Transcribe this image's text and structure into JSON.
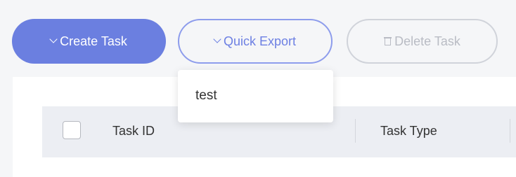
{
  "toolbar": {
    "create_label": "Create Task",
    "export_label": "Quick Export",
    "delete_label": "Delete Task"
  },
  "export_menu": {
    "items": [
      "test"
    ]
  },
  "table": {
    "columns": [
      "Task ID",
      "Task Type"
    ]
  },
  "colors": {
    "primary": "#6b7fe0",
    "primary_border": "#8d9cec",
    "disabled": "#b9bcc4",
    "page_bg": "#f5f6f8",
    "header_bg": "#eceef3"
  },
  "icons": {
    "create": "chevron-down-icon",
    "export": "chevron-down-icon",
    "delete": "trash-icon"
  }
}
